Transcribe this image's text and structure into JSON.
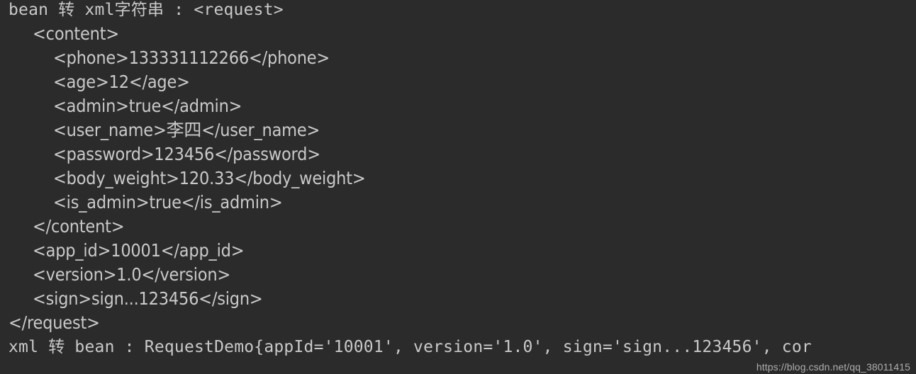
{
  "console": {
    "background_color": "#2b2b2b",
    "text_color": "#c9c9c9",
    "lines": [
      {
        "text": "bean 转 xml字符串 : <request>",
        "indent": 0,
        "style": "mono"
      },
      {
        "text": "<content>",
        "indent": 1,
        "style": "xml"
      },
      {
        "text": "<phone>133331112266</phone>",
        "indent": 2,
        "style": "xml"
      },
      {
        "text": "<age>12</age>",
        "indent": 2,
        "style": "xml"
      },
      {
        "text": "<admin>true</admin>",
        "indent": 2,
        "style": "xml"
      },
      {
        "text": "<user_name>李四</user_name>",
        "indent": 2,
        "style": "xml"
      },
      {
        "text": "<password>123456</password>",
        "indent": 2,
        "style": "xml"
      },
      {
        "text": "<body_weight>120.33</body_weight>",
        "indent": 2,
        "style": "xml"
      },
      {
        "text": "<is_admin>true</is_admin>",
        "indent": 2,
        "style": "xml"
      },
      {
        "text": "</content>",
        "indent": 1,
        "style": "xml"
      },
      {
        "text": "<app_id>10001</app_id>",
        "indent": 1,
        "style": "xml"
      },
      {
        "text": "<version>1.0</version>",
        "indent": 1,
        "style": "xml"
      },
      {
        "text": "<sign>sign...123456</sign>",
        "indent": 1,
        "style": "xml"
      },
      {
        "text": "</request>",
        "indent": 0,
        "style": "xml"
      },
      {
        "text": "xml 转 bean : RequestDemo{appId='10001', version='1.0', sign='sign...123456', cor",
        "indent": 0,
        "style": "mono"
      }
    ]
  },
  "watermark": {
    "text": "https://blog.csdn.net/qq_38011415"
  }
}
